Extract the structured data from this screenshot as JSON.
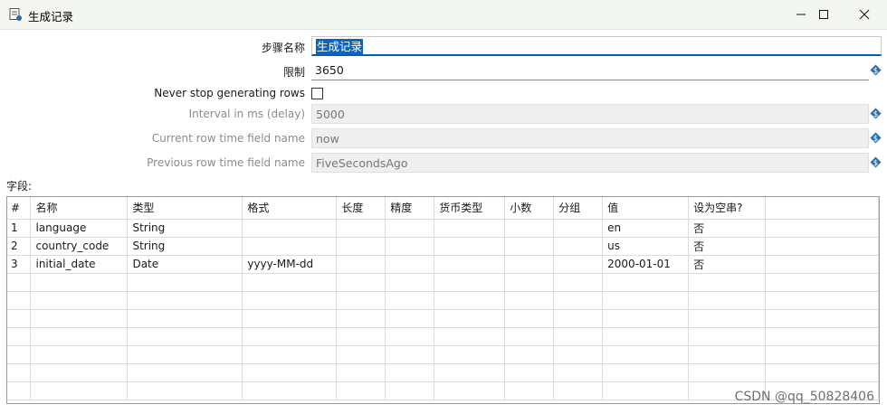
{
  "window": {
    "title": "生成记录"
  },
  "form": {
    "step_name_label": "步骤名称",
    "step_name_value": "生成记录",
    "limit_label": "限制",
    "limit_value": "3650",
    "never_stop_label": "Never stop generating rows",
    "interval_label": "Interval in ms (delay)",
    "interval_value": "5000",
    "current_time_label": "Current row time field name",
    "current_time_value": "now",
    "previous_time_label": "Previous row time field name",
    "previous_time_value": "FiveSecondsAgo"
  },
  "fields": {
    "label": "字段:",
    "columns": [
      "#",
      "名称",
      "类型",
      "格式",
      "长度",
      "精度",
      "货币类型",
      "小数",
      "分组",
      "值",
      "设为空串?"
    ],
    "rows": [
      [
        "1",
        "language",
        "String",
        "",
        "",
        "",
        "",
        "",
        "",
        "en",
        "否"
      ],
      [
        "2",
        "country_code",
        "String",
        "",
        "",
        "",
        "",
        "",
        "",
        "us",
        "否"
      ],
      [
        "3",
        "initial_date",
        "Date",
        "yyyy-MM-dd",
        "",
        "",
        "",
        "",
        "",
        "2000-01-01",
        "否"
      ]
    ],
    "empty_rows": 7
  },
  "watermark": "CSDN @qq_50828406",
  "colors": {
    "selection": "#0a66c2",
    "focus_underline": "#005fb8",
    "variable_icon": "#2e6da4"
  },
  "icons": {
    "app": "table-icon",
    "variable": "dollar-variable-icon"
  }
}
